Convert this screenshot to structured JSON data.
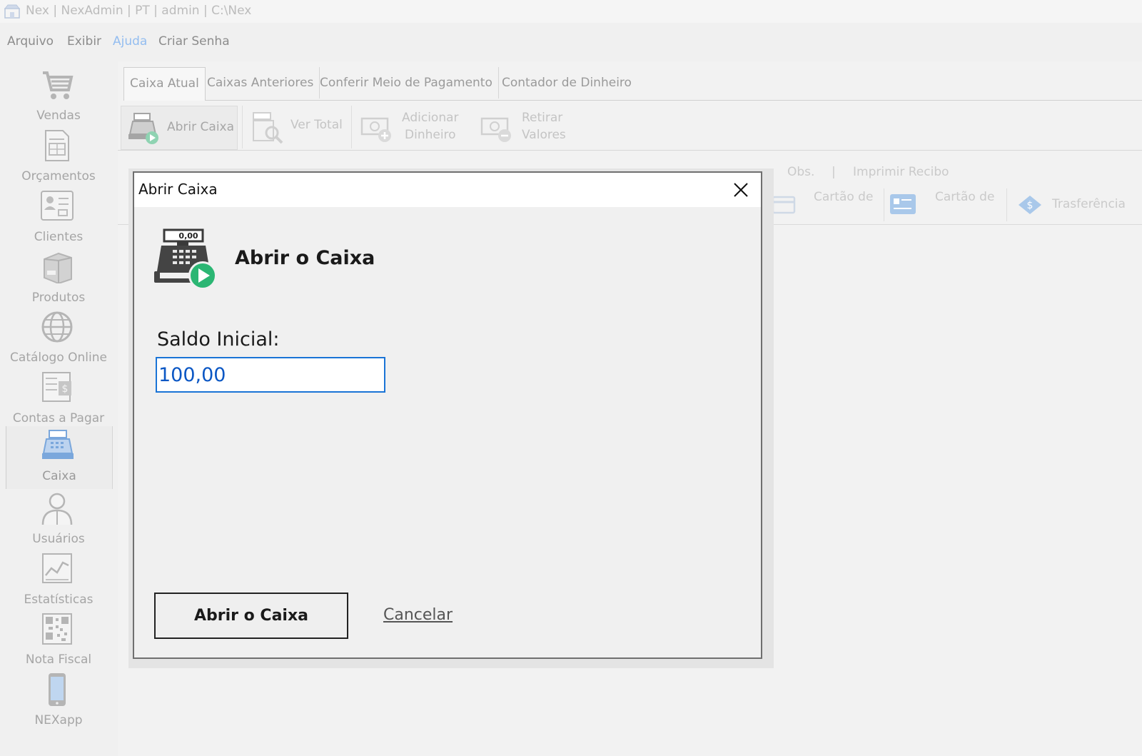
{
  "window": {
    "title": "Nex | NexAdmin | PT | admin | C:\\Nex"
  },
  "menu": {
    "items": [
      {
        "label": "Arquivo"
      },
      {
        "label": "Exibir"
      },
      {
        "label": "Ajuda"
      },
      {
        "label": "Criar Senha"
      }
    ]
  },
  "sidebar": {
    "items": [
      {
        "label": "Vendas",
        "icon": "cart-icon"
      },
      {
        "label": "Orçamentos",
        "icon": "document-icon"
      },
      {
        "label": "Clientes",
        "icon": "contacts-icon"
      },
      {
        "label": "Produtos",
        "icon": "box-icon"
      },
      {
        "label": "Catálogo Online",
        "icon": "globe-icon"
      },
      {
        "label": "Contas a Pagar",
        "icon": "bill-icon"
      },
      {
        "label": "Caixa",
        "icon": "cash-register-icon",
        "active": true
      },
      {
        "label": "Usuários",
        "icon": "user-icon"
      },
      {
        "label": "Estatísticas",
        "icon": "chart-icon"
      },
      {
        "label": "Nota Fiscal",
        "icon": "qr-code-icon"
      },
      {
        "label": "NEXapp",
        "icon": "phone-icon"
      }
    ]
  },
  "tabs": [
    {
      "label": "Caixa Atual",
      "active": true
    },
    {
      "label": "Caixas Anteriores"
    },
    {
      "label": "Conferir Meio de Pagamento"
    },
    {
      "label": "Contador de Dinheiro"
    }
  ],
  "toolbar": {
    "abrir_caixa": "Abrir Caixa",
    "ver_total": "Ver Total",
    "adicionar_line1": "Adicionar",
    "adicionar_line2": "Dinheiro",
    "retirar_line1": "Retirar",
    "retirar_line2": "Valores"
  },
  "background_table": {
    "obs": "Obs.",
    "divider": "|",
    "imprimir_recibo": "Imprimir Recibo",
    "cartao_1": "Cartão de",
    "cartao_2": "Cartão de",
    "transferencia": "Trasferência"
  },
  "dialog": {
    "title": "Abrir Caixa",
    "heading": "Abrir o Caixa",
    "register_display": "0,00",
    "field_label": "Saldo Inicial:",
    "field_value": "100,00",
    "primary_button": "Abrir o Caixa",
    "cancel_link": "Cancelar"
  },
  "colors": {
    "accent_blue": "#1a74d6",
    "play_green": "#2bb673",
    "menu_help": "#93bdf0"
  }
}
